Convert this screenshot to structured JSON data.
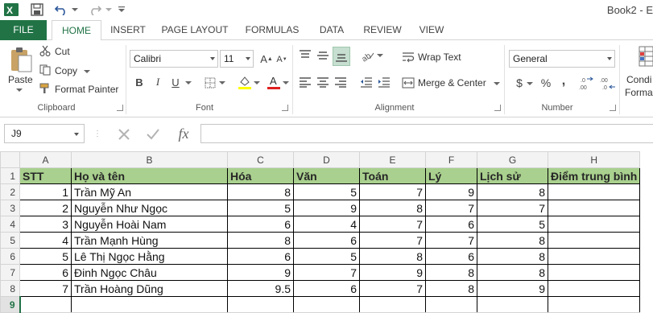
{
  "title_bar": {
    "doc_title": "Book2 - E"
  },
  "tabs": [
    "FILE",
    "HOME",
    "INSERT",
    "PAGE LAYOUT",
    "FORMULAS",
    "DATA",
    "REVIEW",
    "VIEW"
  ],
  "ribbon": {
    "clipboard": {
      "paste": "Paste",
      "cut": "Cut",
      "copy": "Copy",
      "format_painter": "Format Painter",
      "label": "Clipboard"
    },
    "font": {
      "name": "Calibri",
      "size": "11",
      "bold": "B",
      "italic": "I",
      "underline": "U",
      "label": "Font"
    },
    "alignment": {
      "wrap_text": "Wrap Text",
      "merge_center": "Merge & Center",
      "label": "Alignment"
    },
    "number": {
      "format": "General",
      "currency": "$",
      "percent": "%",
      "comma": ",",
      "label": "Number"
    },
    "styles": {
      "conditional_1": "Condi",
      "conditional_2": "Forma"
    }
  },
  "formula_bar": {
    "name_box": "J9",
    "fx": "fx"
  },
  "sheet": {
    "col_headers": [
      "A",
      "B",
      "C",
      "D",
      "E",
      "F",
      "G",
      "H"
    ],
    "row_headers": [
      "1",
      "2",
      "3",
      "4",
      "5",
      "6",
      "7",
      "8",
      "9"
    ],
    "header_row": [
      "STT",
      "Họ và tên",
      "Hóa",
      "Văn",
      "Toán",
      "Lý",
      "Lịch sử",
      "Điểm trung bình"
    ],
    "rows": [
      [
        "1",
        "Trần Mỹ An",
        "8",
        "5",
        "7",
        "9",
        "8",
        ""
      ],
      [
        "2",
        "Nguyễn Như Ngọc",
        "5",
        "9",
        "8",
        "7",
        "7",
        ""
      ],
      [
        "3",
        "Nguyễn Hoài Nam",
        "6",
        "4",
        "7",
        "6",
        "5",
        ""
      ],
      [
        "4",
        "Trần Mạnh Hùng",
        "8",
        "6",
        "7",
        "7",
        "8",
        ""
      ],
      [
        "5",
        "Lê Thị Ngọc Hằng",
        "6",
        "5",
        "8",
        "6",
        "8",
        ""
      ],
      [
        "6",
        "Đinh Ngọc Châu",
        "9",
        "7",
        "9",
        "8",
        "8",
        ""
      ],
      [
        "7",
        "Trần Hoàng Dũng",
        "9.5",
        "6",
        "7",
        "8",
        "9",
        ""
      ]
    ]
  },
  "colors": {
    "excel_green": "#217346",
    "header_fill": "#a9d08e"
  }
}
